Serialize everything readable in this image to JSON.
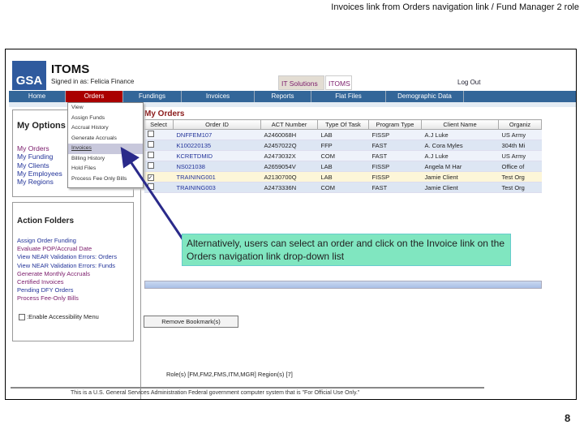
{
  "slide": {
    "title": "Invoices link from Orders navigation link / Fund Manager 2 role",
    "page_number": "8"
  },
  "app": {
    "logo": "GSA",
    "name": "ITOMS",
    "signed_in": "Signed in as: Felicia Finance",
    "tabs": [
      "IT Solutions",
      "ITOMS"
    ],
    "logout": "Log Out"
  },
  "nav": [
    "Home",
    "Orders",
    "Fundings",
    "Invoices",
    "Reports",
    "Flat Files",
    "Demographic Data"
  ],
  "orders_menu": [
    "View",
    "Assign Funds",
    "Accrual History",
    "Generate Accruals",
    "Invoices",
    "Billing History",
    "Hold Files",
    "Process Fee Only Bills"
  ],
  "my_options": {
    "title": "My Options",
    "items": [
      "My Orders",
      "My Funding",
      "My Clients",
      "My Employees",
      "My Regions"
    ]
  },
  "action_folders": {
    "title": "Action Folders",
    "items": [
      "Assign Order Funding",
      "Evaluate POP/Accrual Date",
      "View NEAR Validation Errors: Orders",
      "View NEAR Validation Errors: Funds",
      "Generate Monthly Accruals",
      "Certified Invoices",
      "Pending DFY Orders",
      "Process Fee-Only Bills"
    ],
    "accessibility": ":Enable Accessibility Menu"
  },
  "orders": {
    "title": "My Orders",
    "columns": [
      "Select",
      "Order ID",
      "ACT Number",
      "Type Of Task",
      "Program Type",
      "Client Name",
      "Organiz"
    ],
    "rows": [
      [
        "DNFFEM107",
        "A2460068H",
        "LAB",
        "FISSP",
        "A.J Luke",
        "US Army"
      ],
      [
        "K100220135",
        "A2457022Q",
        "FFP",
        "FAST",
        "A. Cora Myles",
        "304th Mi"
      ],
      [
        "KCRETDMID",
        "A2473032X",
        "COM",
        "FAST",
        "A.J Luke",
        "US Army"
      ],
      [
        "NS021038",
        "A2659054V",
        "LAB",
        "FISSP",
        "Angela M Har",
        "Office of"
      ],
      [
        "TRAINING001",
        "A2130700Q",
        "LAB",
        "FISSP",
        "Jamie Client",
        "Test Org"
      ],
      [
        "TRAINING003",
        "A2473336N",
        "COM",
        "FAST",
        "Jamie Client",
        "Test Org"
      ]
    ],
    "selected_row": 4,
    "remove_bookmarks": "Remove Bookmark(s)"
  },
  "roles": "Role(s) [FM,FM2,FMS,ITM,MGR]    Region(s) [7]",
  "footer": "This is a U.S. General Services Administration Federal government computer system that is \"For Official Use Only.\"",
  "callout": "Alternatively, users can select an order and click on the Invoice link on the Orders navigation link drop-down list",
  "colors": {
    "nav": "#336699",
    "active_nav": "#aa0000",
    "callout": "#80e6c0",
    "arrow": "#2a2a8a"
  }
}
